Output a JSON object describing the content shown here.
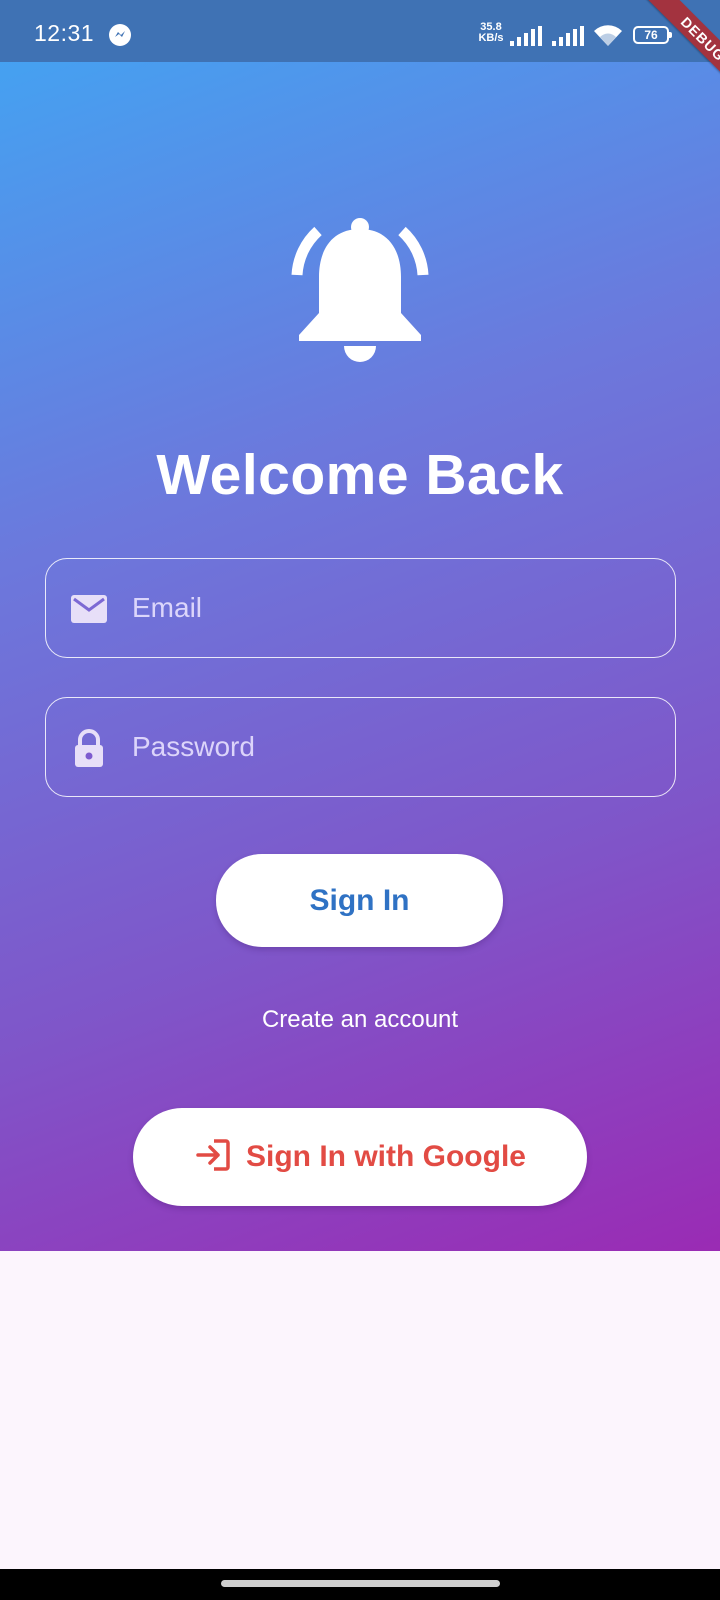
{
  "status_bar": {
    "time": "12:31",
    "net_speed_value": "35.8",
    "net_speed_unit": "KB/s",
    "battery": "76",
    "app_icon": "messenger-icon"
  },
  "debug_banner": "DEBUG",
  "hero": {
    "icon": "bell-icon",
    "title": "Welcome Back"
  },
  "form": {
    "email": {
      "placeholder": "Email",
      "icon": "mail-icon",
      "value": ""
    },
    "password": {
      "placeholder": "Password",
      "icon": "lock-icon",
      "value": ""
    },
    "sign_in_label": "Sign In",
    "create_account_label": "Create an account",
    "google_sign_in_label": "Sign In with Google",
    "google_icon": "login-icon"
  },
  "colors": {
    "gradient_start": "#45a1f1",
    "gradient_end": "#9a2bb4",
    "sign_in_text": "#2f72c4",
    "google_text": "#e24b44",
    "background": "#fcf5fd"
  }
}
